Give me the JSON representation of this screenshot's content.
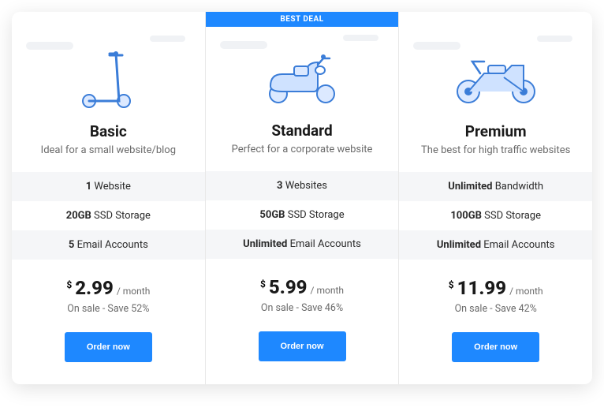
{
  "badge_label": "BEST DEAL",
  "currency": "$",
  "period": "/ month",
  "cta_label": "Order now",
  "plans": [
    {
      "id": "basic",
      "name": "Basic",
      "tagline": "Ideal for a small website/blog",
      "icon": "scooter-icon",
      "featured": false,
      "f1_bold": "1",
      "f1_rest": "Website",
      "f2_bold": "20GB",
      "f2_rest": "SSD Storage",
      "f3_bold": "5",
      "f3_rest": "Email Accounts",
      "price": "2.99",
      "sale": "On sale - Save 52%"
    },
    {
      "id": "standard",
      "name": "Standard",
      "tagline": "Perfect for a corporate website",
      "icon": "moped-icon",
      "featured": true,
      "f1_bold": "3",
      "f1_rest": "Websites",
      "f2_bold": "50GB",
      "f2_rest": "SSD Storage",
      "f3_bold": "Unlimited",
      "f3_rest": "Email Accounts",
      "price": "5.99",
      "sale": "On sale - Save 46%"
    },
    {
      "id": "premium",
      "name": "Premium",
      "tagline": "The best for high traffic websites",
      "icon": "motorcycle-icon",
      "featured": false,
      "f1_bold": "Unlimited",
      "f1_rest": "Bandwidth",
      "f2_bold": "100GB",
      "f2_rest": "SSD Storage",
      "f3_bold": "Unlimited",
      "f3_rest": "Email Accounts",
      "price": "11.99",
      "sale": "On sale - Save 42%"
    }
  ]
}
